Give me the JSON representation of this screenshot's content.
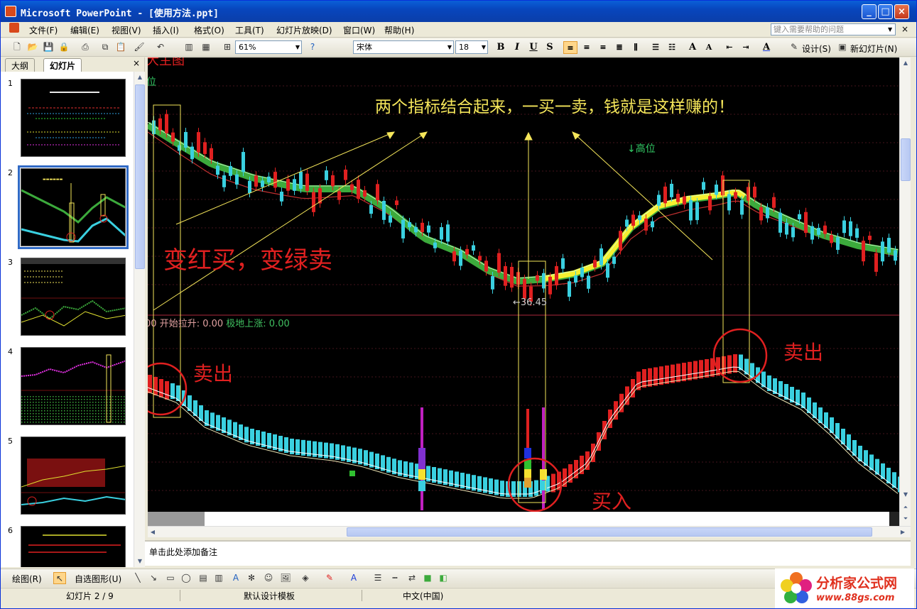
{
  "window": {
    "title": "Microsoft PowerPoint - [使用方法.ppt]",
    "minimize": "_",
    "maximize": "□",
    "close": "×"
  },
  "menubar": {
    "items": [
      "文件(F)",
      "编辑(E)",
      "视图(V)",
      "插入(I)",
      "格式(O)",
      "工具(T)",
      "幻灯片放映(D)",
      "窗口(W)",
      "帮助(H)"
    ],
    "help_placeholder": "键入需要帮助的问题",
    "close": "×"
  },
  "toolbar": {
    "zoom": "61%",
    "font": "宋体",
    "font_size": "18",
    "bold": "B",
    "italic": "I",
    "underline": "U",
    "shadow": "S",
    "design_label": "设计(S)",
    "new_slide_label": "新幻灯片(N)"
  },
  "leftpanel": {
    "tab_outline": "大纲",
    "tab_slides": "幻灯片",
    "close": "×",
    "slide_numbers": [
      "1",
      "2",
      "3",
      "4",
      "5",
      "6"
    ],
    "selected_index": 2
  },
  "slide": {
    "headline": "两个指标结合起来，一买一卖，钱就是这样赚的！",
    "buy_sell_rule": "变红买，变绿卖",
    "sell_label_1": "卖出",
    "sell_label_2": "卖出",
    "buy_label": "买入",
    "high_position": "↓高位",
    "low_value": "←36.45",
    "indicator_prefix": "00",
    "indicator_1": "开始拉升: 0.00",
    "indicator_2": "极地上涨: 0.00",
    "partial_title": "大主图",
    "partial_label": "位"
  },
  "notes": {
    "placeholder": "单击此处添加备注"
  },
  "drawbar": {
    "draw_label": "绘图(R)",
    "autoshapes_label": "自选图形(U)"
  },
  "statusbar": {
    "slide_position": "幻灯片 2 / 9",
    "template": "默认设计模板",
    "language": "中文(中国)"
  },
  "watermark": {
    "name": "分析家公式网",
    "url": "www.88gs.com"
  },
  "colors": {
    "title_bar": "#0a46bd",
    "candle_up": "#e02020",
    "candle_down": "#3ad0e0",
    "highlight_yellow": "#f5e65a",
    "green_band": "#3caa3c"
  }
}
